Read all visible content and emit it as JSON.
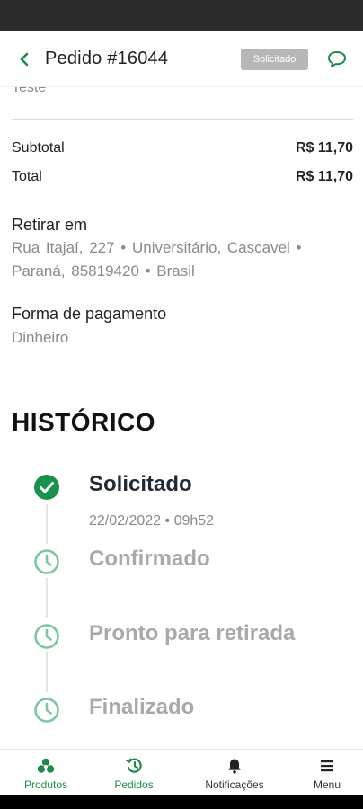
{
  "header": {
    "title": "Pedido #16044",
    "status_badge": "Solicitado"
  },
  "order": {
    "item_note": "Teste",
    "subtotal_label": "Subtotal",
    "subtotal_value": "R$ 11,70",
    "total_label": "Total",
    "total_value": "R$ 11,70",
    "pickup_title": "Retirar em",
    "pickup_address": "Rua Itajaí, 227 • Universitário, Cascavel • Paraná, 85819420 • Brasil",
    "payment_title": "Forma de pagamento",
    "payment_method": "Dinheiro"
  },
  "history": {
    "title": "HISTÓRICO",
    "steps": [
      {
        "label": "Solicitado",
        "date": "22/02/2022 • 09h52",
        "status": "done"
      },
      {
        "label": "Confirmado",
        "status": "pending"
      },
      {
        "label": "Pronto para retirada",
        "status": "pending"
      },
      {
        "label": "Finalizado",
        "status": "pending"
      }
    ]
  },
  "nav": {
    "items": [
      {
        "label": "Produtos",
        "icon": "products-icon",
        "active": true
      },
      {
        "label": "Pedidos",
        "icon": "orders-history-icon",
        "active": true
      },
      {
        "label": "Notificações",
        "icon": "bell-icon",
        "active": false
      },
      {
        "label": "Menu",
        "icon": "hamburger-menu-icon",
        "active": false
      }
    ]
  },
  "colors": {
    "accent": "#1e8a4a",
    "check_green": "#18914a",
    "pending_icon": "#7cc79e",
    "badge_bg": "#b7b7b7"
  }
}
